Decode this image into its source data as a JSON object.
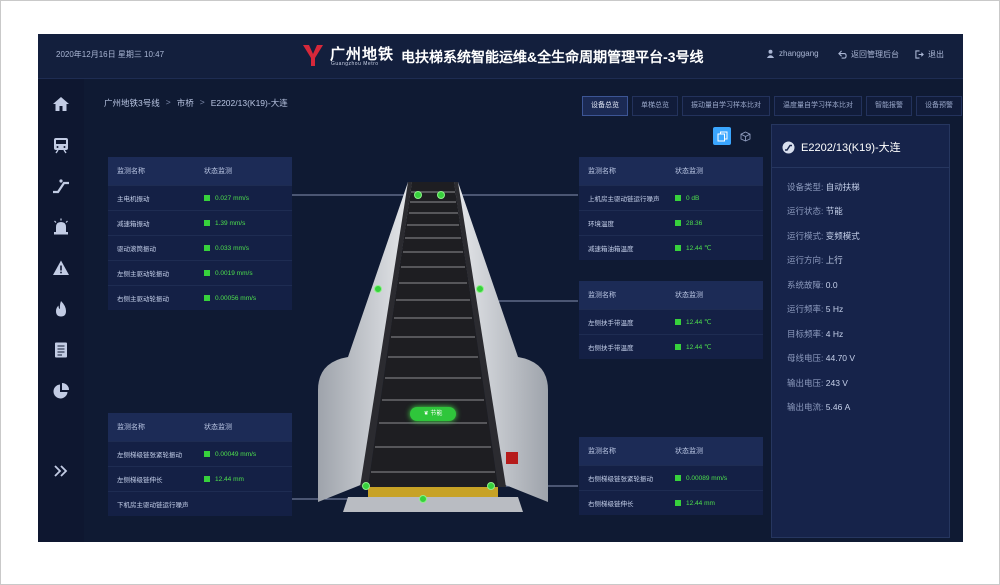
{
  "header": {
    "datetime": "2020年12月16日 星期三 10:47",
    "logo_cn": "广州地铁",
    "logo_en": "Guangzhou Metro",
    "title": "电扶梯系统智能运维&全生命周期管理平台-3号线",
    "user": "zhanggang",
    "back": "返回管理后台",
    "logout": "退出"
  },
  "sidebar": {
    "icons": [
      "home-icon",
      "train-icon",
      "escalator-icon",
      "alarm-light-icon",
      "warning-icon",
      "fire-icon",
      "document-icon",
      "pie-chart-icon",
      "expand-icon"
    ]
  },
  "breadcrumb": {
    "items": [
      "广州地铁3号线",
      "市桥",
      "E2202/13(K19)-大连"
    ],
    "sep": ">"
  },
  "tabs": [
    "设备总览",
    "单梯总览",
    "振动量自学习样本比对",
    "温度量自学习样本比对",
    "智能报警",
    "设备预警"
  ],
  "tables": {
    "top_left": {
      "headers": [
        "监测名称",
        "状态监测"
      ],
      "rows": [
        {
          "name": "主电机振动",
          "value": "0.027 mm/s"
        },
        {
          "name": "减速箱振动",
          "value": "1.39 mm/s"
        },
        {
          "name": "驱动滚筒振动",
          "value": "0.033 mm/s"
        },
        {
          "name": "左侧主驱动轮振动",
          "value": "0.0019 mm/s"
        },
        {
          "name": "右侧主驱动轮振动",
          "value": "0.00056 mm/s"
        }
      ]
    },
    "bottom_left": {
      "headers": [
        "监测名称",
        "状态监测"
      ],
      "rows": [
        {
          "name": "左侧梯级链张紧轮振动",
          "value": "0.00049 mm/s"
        },
        {
          "name": "左侧梯级链伸长",
          "value": "12.44 mm"
        },
        {
          "name": "下机房主驱动链运行噪声",
          "value": ""
        }
      ]
    },
    "top_right": {
      "headers": [
        "监测名称",
        "状态监测"
      ],
      "rows": [
        {
          "name": "上机房主驱动链运行噪声",
          "value": "0 dB"
        },
        {
          "name": "环境温度",
          "value": "28.36"
        },
        {
          "name": "减速箱油箱温度",
          "value": "12.44 ℃"
        }
      ]
    },
    "middle_right": {
      "headers": [
        "监测名称",
        "状态监测"
      ],
      "rows": [
        {
          "name": "左侧扶手带温度",
          "value": "12.44 ℃"
        },
        {
          "name": "右侧扶手带温度",
          "value": "12.44 ℃"
        }
      ]
    },
    "bottom_right": {
      "headers": [
        "监测名称",
        "状态监测"
      ],
      "rows": [
        {
          "name": "右侧梯级链张紧轮振动",
          "value": "0.00089 mm/s"
        },
        {
          "name": "右侧梯级链伸长",
          "value": "12.44 mm"
        }
      ]
    }
  },
  "panel": {
    "title": "E2202/13(K19)-大连",
    "rows": [
      {
        "label": "设备类型:",
        "value": "自动扶梯"
      },
      {
        "label": "运行状态:",
        "value": "节能"
      },
      {
        "label": "运行模式:",
        "value": "变频模式"
      },
      {
        "label": "运行方向:",
        "value": "上行"
      },
      {
        "label": "系统故障:",
        "value": "0.0"
      },
      {
        "label": "运行频率:",
        "value": "5 Hz"
      },
      {
        "label": "目标频率:",
        "value": "4 Hz"
      },
      {
        "label": "母线电压:",
        "value": "44.70 V"
      },
      {
        "label": "输出电压:",
        "value": "243 V"
      },
      {
        "label": "输出电流:",
        "value": "5.46 A"
      }
    ]
  },
  "status_button": "节能",
  "colors": {
    "accent_green": "#37d13c",
    "accent_blue": "#3aa6ff",
    "bg": "#0f1a33"
  }
}
